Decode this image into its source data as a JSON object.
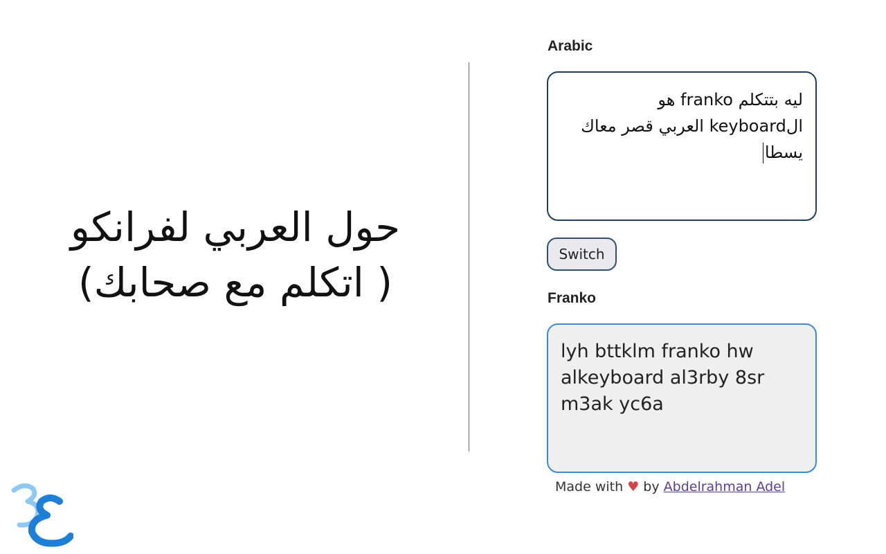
{
  "promo": {
    "line1": "حول العربي لفرانكو",
    "line2": "( اتكلم مع صحابك)"
  },
  "arabic": {
    "label": "Arabic",
    "text": "ليه بتتكلم franko هو الkeyboard العربي قصر معاك يسطا"
  },
  "switch_label": "Switch",
  "franko": {
    "label": "Franko",
    "text": "lyh bttklm franko hw alkeyboard al3rby 8sr m3ak yc6a"
  },
  "footer": {
    "made_with": "Made with",
    "heart": "♥",
    "by": "by",
    "author": "Abdelrahman Adel"
  },
  "logo": {
    "icon": "3e-logo-icon",
    "colors": {
      "light": "#8ec8f5",
      "dark": "#1e7fd6"
    }
  }
}
